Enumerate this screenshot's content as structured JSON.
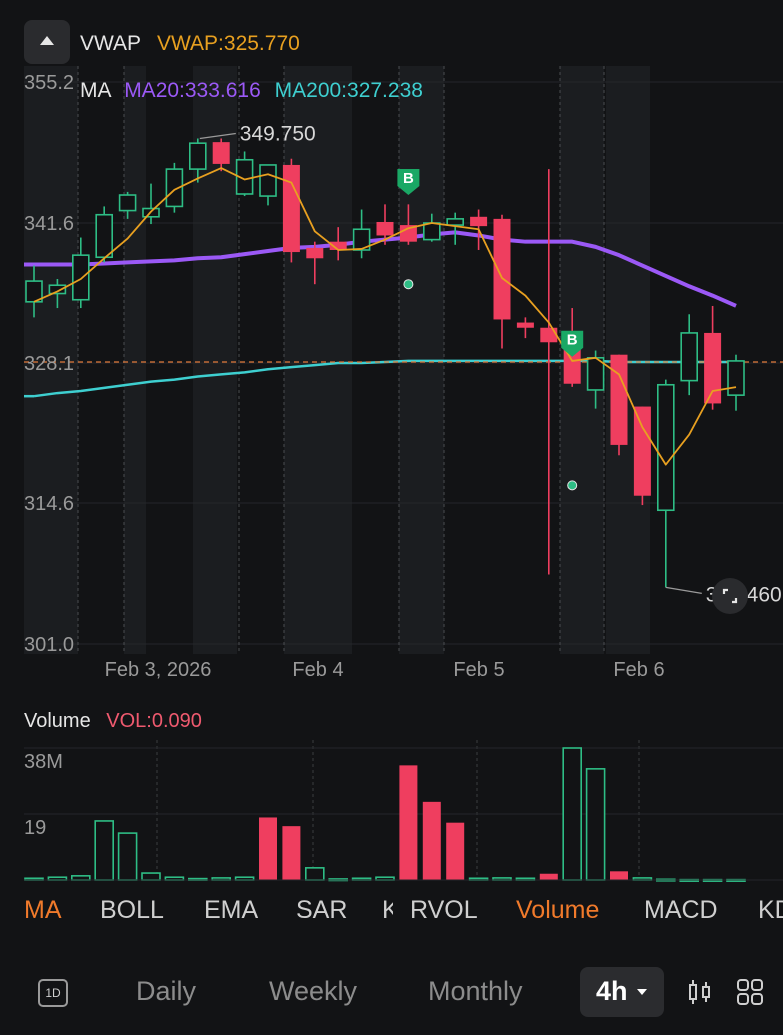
{
  "header": {
    "vwap_label": "VWAP",
    "vwap_value": "VWAP:325.770"
  },
  "indicators": {
    "ma_label": "MA",
    "ma20": "MA20:333.616",
    "ma200": "MA200:327.238"
  },
  "price_chart": {
    "y_ticks": [
      "355.2",
      "341.6",
      "328.1",
      "314.6",
      "301.0"
    ],
    "x_ticks": [
      "Feb 3, 2026",
      "Feb 4",
      "Feb 5",
      "Feb 6"
    ],
    "high_label": "349.750",
    "low_label": "306.460",
    "signal_glyph": "B"
  },
  "volume_panel": {
    "title": "Volume",
    "vol_value": "VOL:0.090",
    "y_ticks": [
      "38M",
      "19"
    ]
  },
  "tabs": [
    "MA",
    "BOLL",
    "EMA",
    "SAR",
    "K",
    "RVOL",
    "Volume",
    "MACD",
    "KD"
  ],
  "periods": {
    "daily": "Daily",
    "weekly": "Weekly",
    "monthly": "Monthly",
    "selected": "4h",
    "one_d": "1D"
  },
  "colors": {
    "up": "#2ebd85",
    "down": "#ef3e5f",
    "vwap": "#e8a020",
    "ma20": "#9b59f6",
    "ma200": "#3ecfd0",
    "active_tab": "#f07a2b",
    "last_price": "#e07a3a"
  },
  "chart_data": {
    "type": "candlestick",
    "interval": "4h",
    "y_range": [
      301.0,
      355.2
    ],
    "candles": [
      {
        "o": 334.0,
        "h": 337.5,
        "l": 332.5,
        "c": 336.0
      },
      {
        "o": 334.8,
        "h": 336.2,
        "l": 333.4,
        "c": 335.6
      },
      {
        "o": 334.2,
        "h": 340.2,
        "l": 333.4,
        "c": 338.5
      },
      {
        "o": 338.3,
        "h": 343.2,
        "l": 337.8,
        "c": 342.4
      },
      {
        "o": 342.8,
        "h": 344.6,
        "l": 342.0,
        "c": 344.3
      },
      {
        "o": 342.2,
        "h": 345.4,
        "l": 341.5,
        "c": 343.0
      },
      {
        "o": 343.2,
        "h": 347.4,
        "l": 342.6,
        "c": 346.8
      },
      {
        "o": 346.8,
        "h": 349.75,
        "l": 345.5,
        "c": 349.3
      },
      {
        "o": 349.4,
        "h": 349.75,
        "l": 346.6,
        "c": 347.3
      },
      {
        "o": 344.4,
        "h": 348.5,
        "l": 344.2,
        "c": 347.7
      },
      {
        "o": 344.2,
        "h": 346.8,
        "l": 343.3,
        "c": 347.2
      },
      {
        "o": 347.2,
        "h": 347.8,
        "l": 337.8,
        "c": 338.8
      },
      {
        "o": 339.2,
        "h": 339.8,
        "l": 335.7,
        "c": 338.2
      },
      {
        "o": 339.8,
        "h": 341.2,
        "l": 338.0,
        "c": 339.0
      },
      {
        "o": 339.0,
        "h": 342.9,
        "l": 338.2,
        "c": 341.0
      },
      {
        "o": 341.7,
        "h": 343.4,
        "l": 339.5,
        "c": 340.4
      },
      {
        "o": 341.4,
        "h": 343.4,
        "l": 339.5,
        "c": 339.8
      },
      {
        "o": 340.0,
        "h": 342.5,
        "l": 339.8,
        "c": 341.6
      },
      {
        "o": 341.4,
        "h": 342.6,
        "l": 339.5,
        "c": 342.0
      },
      {
        "o": 342.2,
        "h": 342.9,
        "l": 339.0,
        "c": 341.3
      },
      {
        "o": 342.0,
        "h": 342.4,
        "l": 329.5,
        "c": 332.3
      },
      {
        "o": 332.0,
        "h": 332.5,
        "l": 330.5,
        "c": 331.5
      },
      {
        "o": 331.5,
        "h": 346.8,
        "l": 307.7,
        "c": 330.1
      },
      {
        "o": 330.3,
        "h": 333.4,
        "l": 325.8,
        "c": 326.1
      },
      {
        "o": 325.5,
        "h": 329.3,
        "l": 323.7,
        "c": 328.6
      },
      {
        "o": 328.9,
        "h": 328.9,
        "l": 319.2,
        "c": 320.2
      },
      {
        "o": 323.9,
        "h": 323.9,
        "l": 314.4,
        "c": 315.3
      },
      {
        "o": 313.9,
        "h": 326.5,
        "l": 306.46,
        "c": 326.0
      },
      {
        "o": 326.4,
        "h": 332.8,
        "l": 325.0,
        "c": 331.0
      },
      {
        "o": 331.0,
        "h": 333.6,
        "l": 323.6,
        "c": 324.2
      },
      {
        "o": 325.0,
        "h": 328.9,
        "l": 323.5,
        "c": 328.3
      }
    ],
    "vwap_line": [
      334.0,
      335.0,
      336.2,
      338.2,
      340.1,
      342.7,
      344.8,
      345.9,
      346.9,
      345.8,
      346.3,
      345.5,
      340.8,
      339.0,
      339.1,
      340.0,
      341.1,
      341.6,
      341.3,
      341.0,
      336.3,
      334.6,
      332.0,
      328.3,
      328.6,
      327.0,
      321.9,
      318.3,
      321.2,
      325.4,
      325.77
    ],
    "ma20_line": [
      337.6,
      337.6,
      337.6,
      337.7,
      337.8,
      337.9,
      338.0,
      338.2,
      338.3,
      338.6,
      338.9,
      339.2,
      339.3,
      339.5,
      339.8,
      340.0,
      340.2,
      340.5,
      340.7,
      340.4,
      340.0,
      339.8,
      339.8,
      339.8,
      339.3,
      338.5,
      337.5,
      336.5,
      335.5,
      334.6,
      333.616
    ],
    "ma200_line": [
      324.9,
      325.2,
      325.4,
      325.7,
      326.0,
      326.3,
      326.5,
      326.8,
      327.0,
      327.2,
      327.5,
      327.7,
      327.9,
      328.1,
      328.1,
      328.2,
      328.3,
      328.3,
      328.3,
      328.3,
      328.3,
      328.3,
      328.3,
      328.3,
      328.3,
      328.2,
      328.2,
      328.2,
      328.2,
      328.2,
      328.2
    ],
    "last_price": 328.2,
    "signals": [
      {
        "index": 16,
        "label": "B",
        "price": 344.5
      },
      {
        "index": 23,
        "label": "B",
        "price": 328.9
      }
    ],
    "green_dots": [
      {
        "index": 16,
        "price": 335.7
      },
      {
        "index": 23,
        "price": 316.3
      }
    ],
    "volume": {
      "y_range": [
        0,
        38
      ],
      "units": "M",
      "values": [
        0.5,
        0.8,
        1.2,
        17.0,
        13.5,
        2.0,
        0.8,
        0.4,
        0.6,
        0.8,
        18.0,
        15.5,
        3.5,
        0.3,
        0.5,
        0.8,
        33.0,
        22.5,
        16.5,
        0.5,
        0.6,
        0.5,
        1.8,
        38.0,
        32.0,
        2.5,
        0.6,
        0.2,
        0.1,
        0.1,
        0.1
      ],
      "up": [
        true,
        true,
        true,
        true,
        true,
        true,
        true,
        true,
        true,
        true,
        false,
        false,
        true,
        true,
        true,
        true,
        false,
        false,
        false,
        true,
        true,
        true,
        false,
        true,
        true,
        false,
        true,
        true,
        true,
        true,
        true
      ]
    }
  }
}
